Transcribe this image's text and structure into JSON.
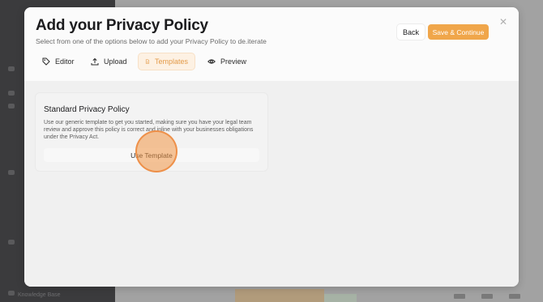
{
  "modal": {
    "title": "Add your Privacy Policy",
    "subtitle": "Select from one of the options below to add your Privacy Policy to de.iterate",
    "back_label": "Back",
    "save_label": "Save & Continue",
    "close_icon": "close-icon"
  },
  "tabs": [
    {
      "label": "Editor",
      "icon": "tag-icon",
      "active": false
    },
    {
      "label": "Upload",
      "icon": "upload-icon",
      "active": false
    },
    {
      "label": "Templates",
      "icon": "document-icon",
      "active": true
    },
    {
      "label": "Preview",
      "icon": "eye-icon",
      "active": false
    }
  ],
  "template_card": {
    "title": "Standard Privacy Policy",
    "description": "Use our generic template to get you started, making sure you have your legal team review and approve this policy is correct and inline with your businesses obligations under the Privacy Act.",
    "button_label": "Use Template"
  },
  "background": {
    "footer_label": "Knowledge Base"
  },
  "colors": {
    "accent": "#f0a64a",
    "active_tab_bg": "#fdf1e3",
    "active_tab_text": "#e39a48"
  }
}
